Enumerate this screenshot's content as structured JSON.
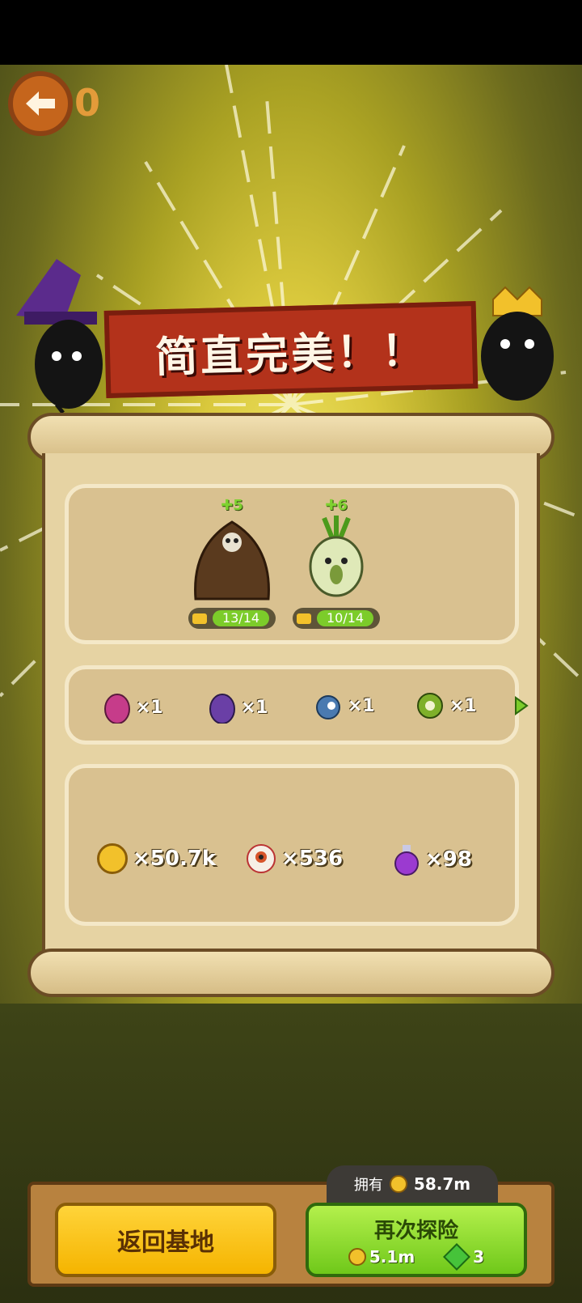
{
  "back": {
    "count": "0"
  },
  "banner": {
    "title": "简直完美！！"
  },
  "monsters": [
    {
      "plus": "✚5",
      "level": "13/14"
    },
    {
      "plus": "✚6",
      "level": "10/14"
    }
  ],
  "items": [
    {
      "icon": "pink-egg-icon",
      "count": "×1"
    },
    {
      "icon": "purple-egg-icon",
      "count": "×1"
    },
    {
      "icon": "blue-creature-icon",
      "count": "×1"
    },
    {
      "icon": "green-creature-icon",
      "count": "×1"
    }
  ],
  "resources": [
    {
      "icon": "coin-icon",
      "count": "×50.7k"
    },
    {
      "icon": "eyeball-icon",
      "count": "×536"
    },
    {
      "icon": "potion-icon",
      "count": "×98"
    }
  ],
  "footer": {
    "own_label": "拥有",
    "own_value": "58.7m",
    "return_label": "返回基地",
    "again_label": "再次探险",
    "cost_coins": "5.1m",
    "cost_gems": "3"
  },
  "colors": {
    "banner": "#b3321b",
    "return_button": "#f5b400",
    "again_button": "#6fc81a"
  }
}
